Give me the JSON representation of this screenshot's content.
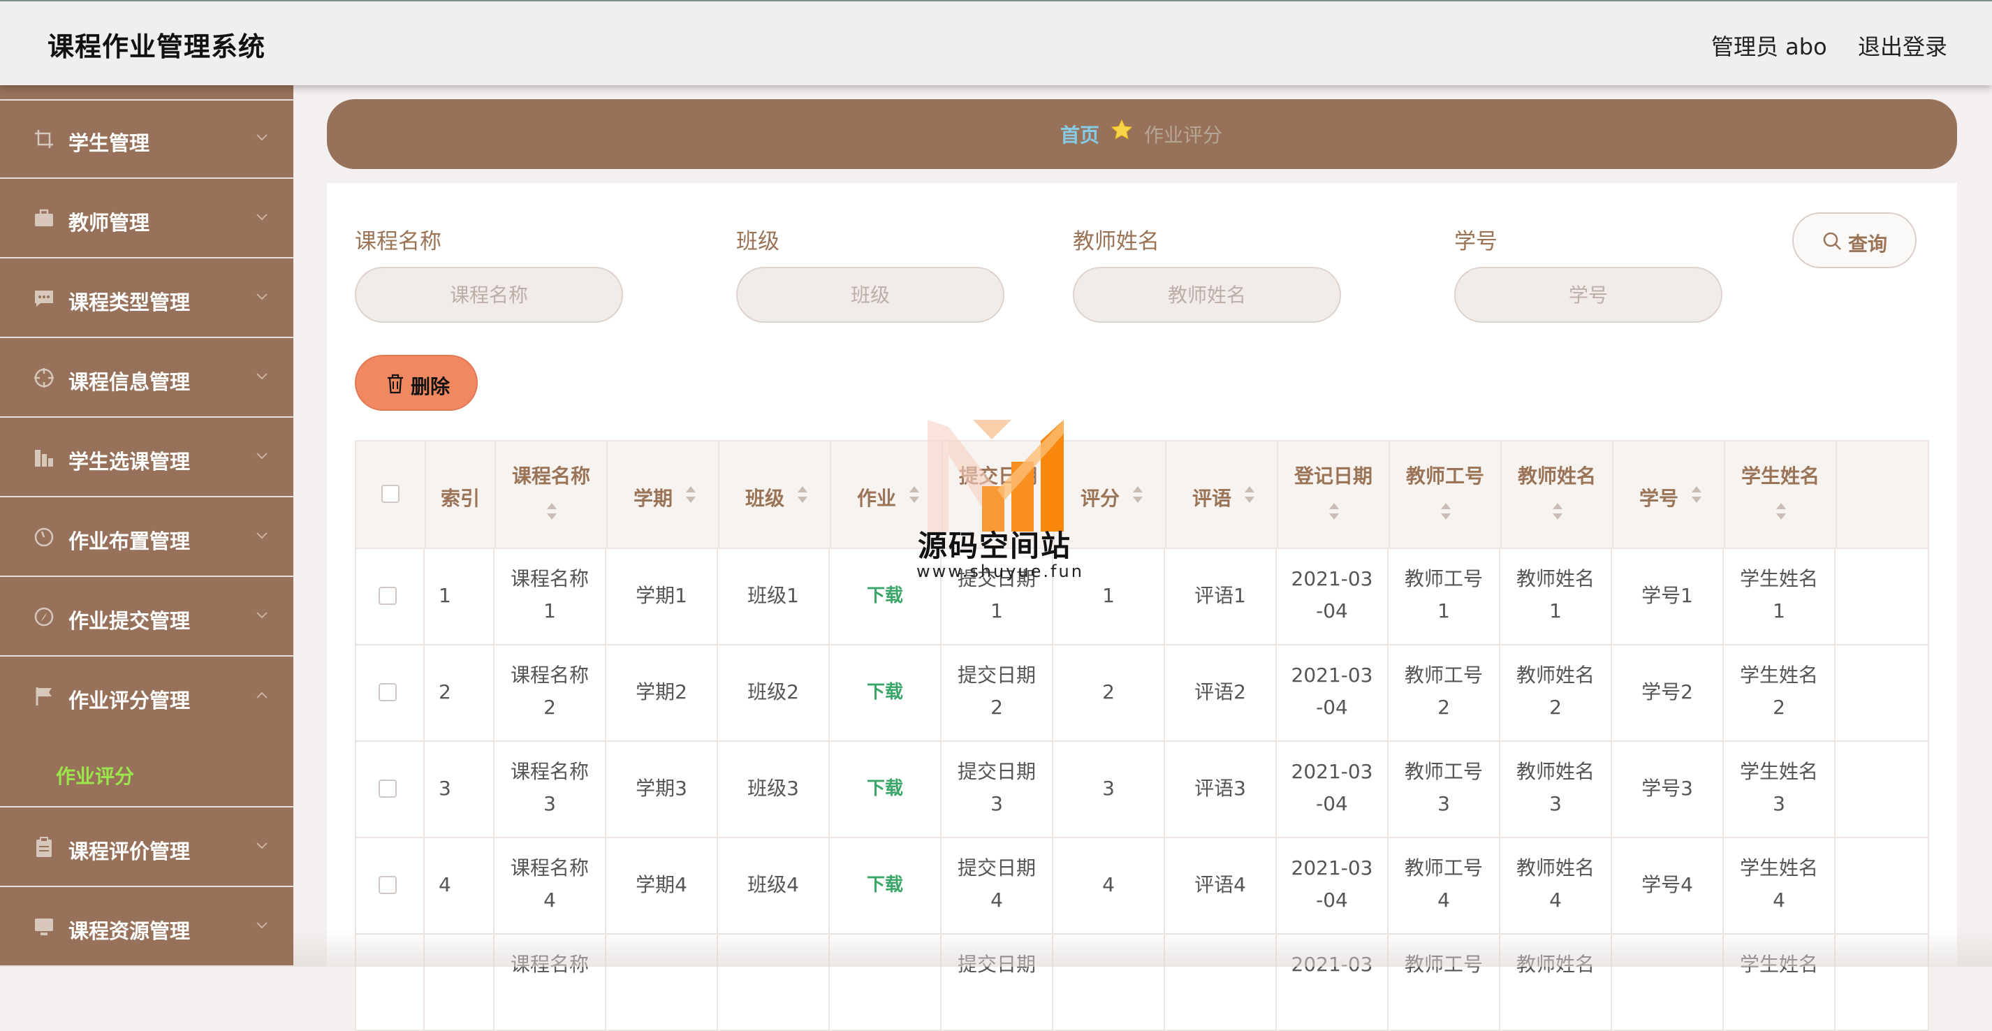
{
  "header": {
    "app_title": "课程作业管理系统",
    "admin_label": "管理员 abo",
    "logout_label": "退出登录"
  },
  "sidebar": {
    "items": [
      {
        "label": "学生管理",
        "icon": "crop-icon"
      },
      {
        "label": "教师管理",
        "icon": "briefcase-icon"
      },
      {
        "label": "课程类型管理",
        "icon": "chat-icon"
      },
      {
        "label": "课程信息管理",
        "icon": "target-icon"
      },
      {
        "label": "学生选课管理",
        "icon": "chart-icon"
      },
      {
        "label": "作业布置管理",
        "icon": "gauge-icon"
      },
      {
        "label": "作业提交管理",
        "icon": "compass-icon"
      },
      {
        "label": "作业评分管理",
        "icon": "flag-icon",
        "expanded": true,
        "sub": "作业评分"
      },
      {
        "label": "课程评价管理",
        "icon": "clipboard-icon"
      },
      {
        "label": "课程资源管理",
        "icon": "monitor-icon"
      }
    ]
  },
  "breadcrumb": {
    "home": "首页",
    "current": "作业评分"
  },
  "filters": {
    "course_label": "课程名称",
    "course_placeholder": "课程名称",
    "class_label": "班级",
    "class_placeholder": "班级",
    "teacher_label": "教师姓名",
    "teacher_placeholder": "教师姓名",
    "student_no_label": "学号",
    "student_no_placeholder": "学号",
    "query_label": "查询"
  },
  "actions": {
    "delete_label": "删除"
  },
  "table": {
    "columns": [
      "索引",
      "课程名称",
      "学期",
      "班级",
      "作业",
      "提交日期",
      "评分",
      "评语",
      "登记日期",
      "教师工号",
      "教师姓名",
      "学号",
      "学生姓名"
    ],
    "rows": [
      {
        "index": "1",
        "course": [
          "课程名称",
          "1"
        ],
        "term": "学期1",
        "class": "班级1",
        "homework": "下载",
        "submit": [
          "提交日期",
          "1"
        ],
        "score": "1",
        "comment": "评语1",
        "date": [
          "2021-03",
          "-04"
        ],
        "tno": [
          "教师工号",
          "1"
        ],
        "tname": [
          "教师姓名",
          "1"
        ],
        "sno": "学号1",
        "sname": [
          "学生姓名",
          "1"
        ]
      },
      {
        "index": "2",
        "course": [
          "课程名称",
          "2"
        ],
        "term": "学期2",
        "class": "班级2",
        "homework": "下载",
        "submit": [
          "提交日期",
          "2"
        ],
        "score": "2",
        "comment": "评语2",
        "date": [
          "2021-03",
          "-04"
        ],
        "tno": [
          "教师工号",
          "2"
        ],
        "tname": [
          "教师姓名",
          "2"
        ],
        "sno": "学号2",
        "sname": [
          "学生姓名",
          "2"
        ]
      },
      {
        "index": "3",
        "course": [
          "课程名称",
          "3"
        ],
        "term": "学期3",
        "class": "班级3",
        "homework": "下载",
        "submit": [
          "提交日期",
          "3"
        ],
        "score": "3",
        "comment": "评语3",
        "date": [
          "2021-03",
          "-04"
        ],
        "tno": [
          "教师工号",
          "3"
        ],
        "tname": [
          "教师姓名",
          "3"
        ],
        "sno": "学号3",
        "sname": [
          "学生姓名",
          "3"
        ]
      },
      {
        "index": "4",
        "course": [
          "课程名称",
          "4"
        ],
        "term": "学期4",
        "class": "班级4",
        "homework": "下载",
        "submit": [
          "提交日期",
          "4"
        ],
        "score": "4",
        "comment": "评语4",
        "date": [
          "2021-03",
          "-04"
        ],
        "tno": [
          "教师工号",
          "4"
        ],
        "tname": [
          "教师姓名",
          "4"
        ],
        "sno": "学号4",
        "sname": [
          "学生姓名",
          "4"
        ]
      },
      {
        "index": "",
        "course": [
          "课程名称",
          ""
        ],
        "term": "",
        "class": "",
        "homework": "",
        "submit": [
          "提交日期",
          ""
        ],
        "score": "",
        "comment": "",
        "date": [
          "2021-03",
          ""
        ],
        "tno": [
          "教师工号",
          ""
        ],
        "tname": [
          "教师姓名",
          ""
        ],
        "sno": "",
        "sname": [
          "学生姓名",
          ""
        ]
      }
    ]
  },
  "watermark": {
    "title": "源码空间站",
    "url": "www.shuyue.fun"
  },
  "colors": {
    "brand_brown": "#98715a",
    "accent_orange": "#f08862",
    "link_green": "#3aa668",
    "breadcrumb_home": "#86cbe6"
  }
}
